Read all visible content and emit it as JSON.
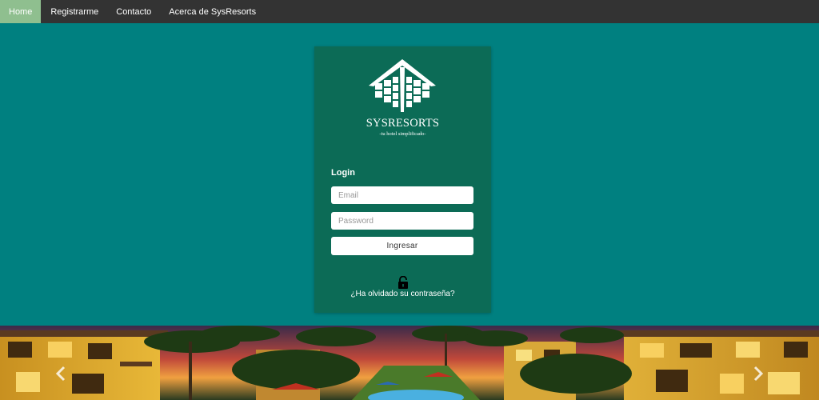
{
  "nav": {
    "items": [
      {
        "label": "Home",
        "active": true
      },
      {
        "label": "Registrarme",
        "active": false
      },
      {
        "label": "Contacto",
        "active": false
      },
      {
        "label": "Acerca de SysResorts",
        "active": false
      }
    ]
  },
  "login": {
    "brand": "SYSRESORTS",
    "tagline": "-tu hotel simplificado-",
    "title": "Login",
    "email_placeholder": "Email",
    "password_placeholder": "Password",
    "submit_label": "Ingresar",
    "forgot_label": "¿Ha olvidado su contraseña?"
  },
  "colors": {
    "navbar": "#333333",
    "nav_active": "#8fbf8f",
    "background": "#008080",
    "card": "#0c6b56"
  },
  "icons": {
    "logo": "hotel-building-logo",
    "lock": "unlocked-padlock-icon",
    "prev": "chevron-left-icon",
    "next": "chevron-right-icon"
  }
}
